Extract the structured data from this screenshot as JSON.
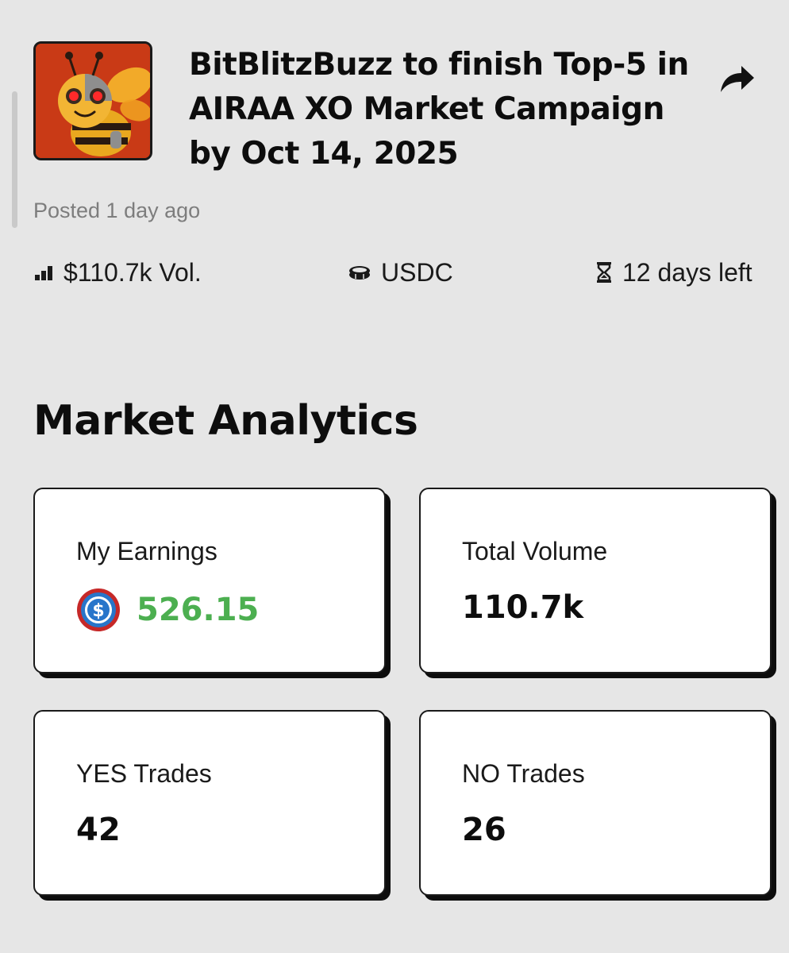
{
  "market": {
    "title": "BitBlitzBuzz to finish Top-5 in AIRAA XO Market Campaign by Oct 14, 2025",
    "posted": "Posted 1 day ago",
    "image_icon": "bee-robot-avatar",
    "share_icon": "share-arrow-icon"
  },
  "stats": {
    "volume": "$110.7k Vol.",
    "volume_icon": "bar-chart-icon",
    "currency": "USDC",
    "currency_icon": "coins-icon",
    "time_left": "12 days left",
    "time_icon": "hourglass-icon"
  },
  "analytics": {
    "title": "Market Analytics",
    "cards": [
      {
        "label": "My Earnings",
        "value": "526.15",
        "icon": "usdc-coin-icon"
      },
      {
        "label": "Total Volume",
        "value": "110.7k"
      },
      {
        "label": "YES Trades",
        "value": "42"
      },
      {
        "label": "NO Trades",
        "value": "26"
      }
    ]
  },
  "colors": {
    "background": "#e6e6e6",
    "earnings_green": "#4caf50",
    "usdc_blue": "#2775ca",
    "image_red": "#c93a16"
  }
}
